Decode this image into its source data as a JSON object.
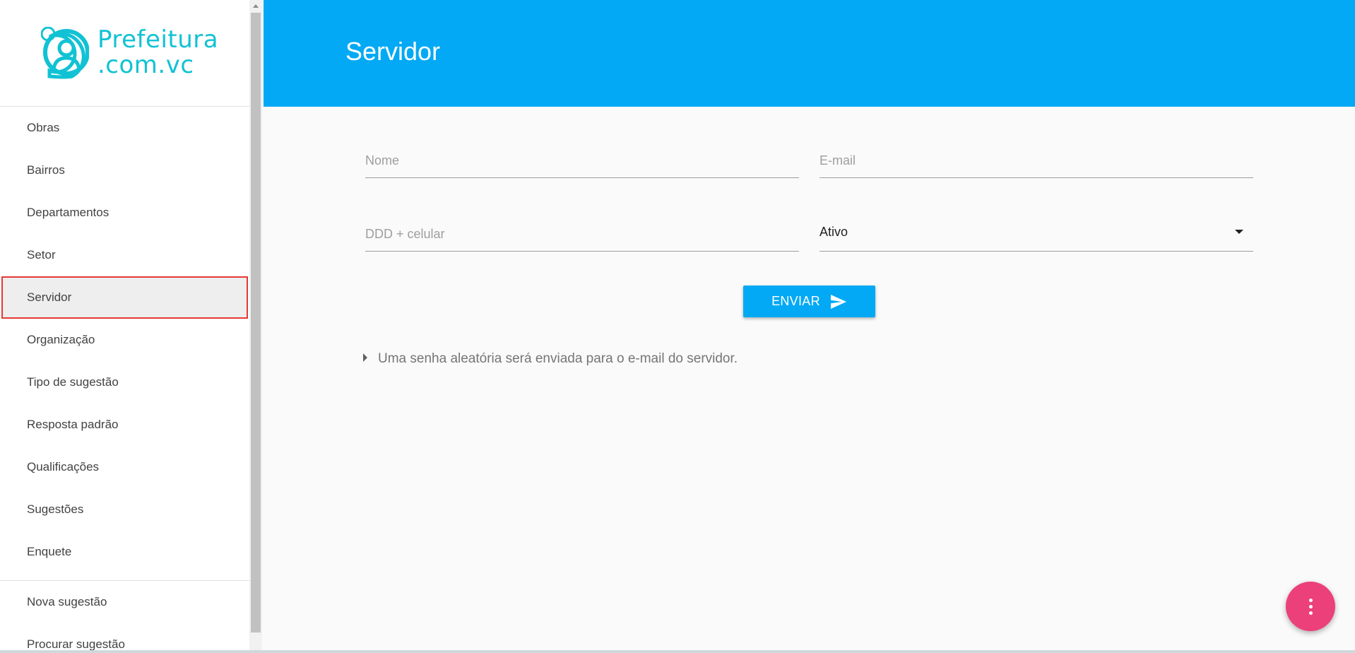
{
  "brand": {
    "line1": "Prefeitura",
    "line2": ".com.vc",
    "color": "#11c2d4"
  },
  "sidebar": {
    "items": [
      {
        "label": "Obras"
      },
      {
        "label": "Bairros"
      },
      {
        "label": "Departamentos"
      },
      {
        "label": "Setor"
      },
      {
        "label": "Servidor",
        "selected": true
      },
      {
        "label": "Organização"
      },
      {
        "label": "Tipo de sugestão"
      },
      {
        "label": "Resposta padrão"
      },
      {
        "label": "Qualificações"
      },
      {
        "label": "Sugestões"
      },
      {
        "label": "Enquete"
      }
    ],
    "bottom_items": [
      {
        "label": "Nova sugestão"
      },
      {
        "label": "Procurar sugestão"
      }
    ]
  },
  "header": {
    "title": "Servidor",
    "color": "#03a9f4"
  },
  "form": {
    "nome_placeholder": "Nome",
    "email_placeholder": "E-mail",
    "ddd_placeholder": "DDD + celular",
    "status_value": "Ativo",
    "send_label": "ENVIAR"
  },
  "info_text": "Uma senha aleatória será enviada para o e-mail do servidor.",
  "icons": {
    "send": "send-icon",
    "fab": "more-vert-icon",
    "caret": "arrow-drop-down-icon"
  },
  "fab_color": "#ec407a"
}
